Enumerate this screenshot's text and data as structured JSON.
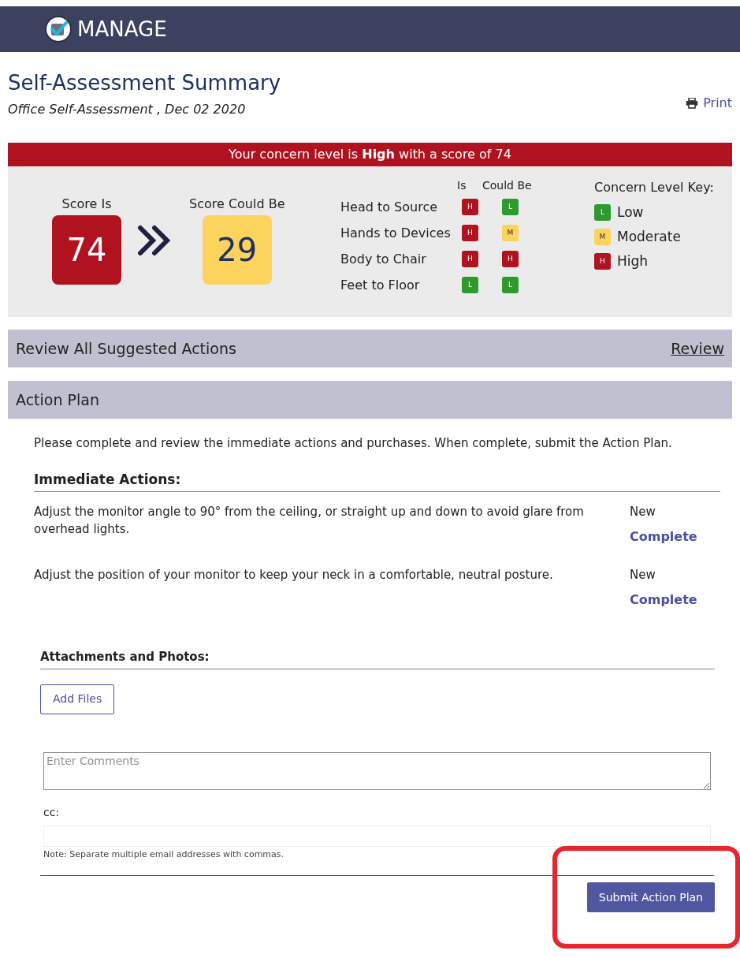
{
  "header": {
    "title": "MANAGE"
  },
  "page": {
    "title": "Self-Assessment Summary",
    "subtitle": "Office Self-Assessment , Dec 02 2020",
    "print": "Print"
  },
  "banner": "Your concern level is **High** with a score of 74",
  "scores": [
    {
      "label": "Score Is",
      "value": "74",
      "color": "#b0131f"
    },
    {
      "label": "Score Could Be",
      "value": "29",
      "color": "#fcd35c"
    }
  ],
  "factors": {
    "columns": [
      "Is",
      "Could Be"
    ],
    "rows": [
      {
        "name": "Head to Source",
        "is": {
          "letter": "H",
          "color": "#b0131f"
        },
        "could_be": {
          "letter": "L",
          "color": "#2e9a2e"
        }
      },
      {
        "name": "Hands to Devices",
        "is": {
          "letter": "H",
          "color": "#b0131f"
        },
        "could_be": {
          "letter": "M",
          "color": "#fcd35c"
        }
      },
      {
        "name": "Body to Chair",
        "is": {
          "letter": "H",
          "color": "#b0131f"
        },
        "could_be": {
          "letter": "H",
          "color": "#b0131f"
        }
      },
      {
        "name": "Feet to Floor",
        "is": {
          "letter": "L",
          "color": "#2e9a2e"
        },
        "could_be": {
          "letter": "L",
          "color": "#2e9a2e"
        }
      }
    ]
  },
  "key": {
    "title": "Concern Level Key:",
    "items": [
      {
        "letter": "L",
        "label": "Low",
        "color": "#2e9a2e"
      },
      {
        "letter": "M",
        "label": "Moderate",
        "color": "#fcd35c"
      },
      {
        "letter": "H",
        "label": "High",
        "color": "#b0131f"
      }
    ]
  },
  "review": {
    "title": "Review All Suggested Actions",
    "link": "Review"
  },
  "action_plan": {
    "title": "Action Plan",
    "intro": "Please complete and review the immediate actions and purchases. When complete, submit the Action Plan.",
    "actions_heading": "Immediate Actions:",
    "actions": [
      {
        "text": "Adjust the monitor angle to 90° from the ceiling, or straight up and down to avoid glare from overhead lights.",
        "status": "New",
        "link": "Complete"
      },
      {
        "text": "Adjust the position of your monitor to keep your neck in a comfortable, neutral posture.",
        "status": "New",
        "link": "Complete"
      }
    ],
    "attachments_heading": "Attachments and Photos:",
    "add_files": "Add Files",
    "comments_placeholder": "Enter Comments",
    "cc_label": "cc:",
    "note": "Note: Separate multiple email addresses with commas.",
    "submit": "Submit Action Plan",
    "submit_highlighted": true
  }
}
